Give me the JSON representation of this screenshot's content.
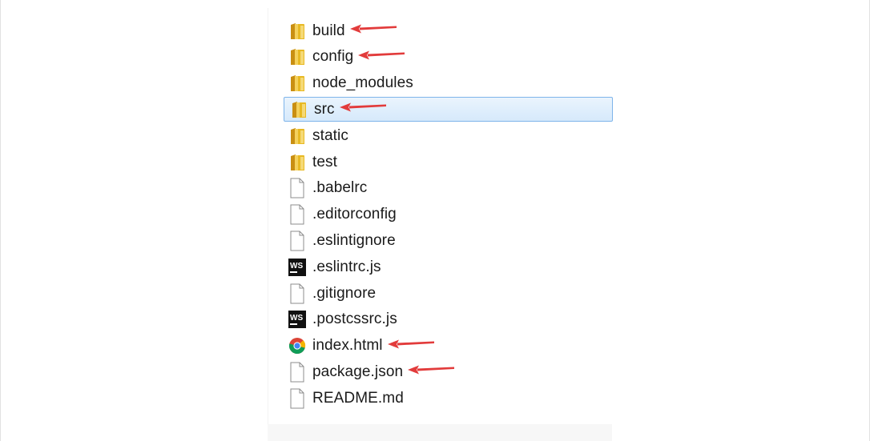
{
  "explorer": {
    "files": [
      {
        "name": "build",
        "kind": "folder",
        "annotated": true
      },
      {
        "name": "config",
        "kind": "folder",
        "annotated": true
      },
      {
        "name": "node_modules",
        "kind": "folder",
        "annotated": false
      },
      {
        "name": "src",
        "kind": "folder",
        "annotated": true,
        "selected": true
      },
      {
        "name": "static",
        "kind": "folder",
        "annotated": false
      },
      {
        "name": "test",
        "kind": "folder",
        "annotated": false
      },
      {
        "name": ".babelrc",
        "kind": "file",
        "annotated": false
      },
      {
        "name": ".editorconfig",
        "kind": "file",
        "annotated": false
      },
      {
        "name": ".eslintignore",
        "kind": "file",
        "annotated": false
      },
      {
        "name": ".eslintrc.js",
        "kind": "webstorm-js",
        "annotated": false
      },
      {
        "name": ".gitignore",
        "kind": "file",
        "annotated": false
      },
      {
        "name": ".postcssrc.js",
        "kind": "webstorm-js",
        "annotated": false
      },
      {
        "name": "index.html",
        "kind": "chrome-html",
        "annotated": true
      },
      {
        "name": "package.json",
        "kind": "file",
        "annotated": true
      },
      {
        "name": "README.md",
        "kind": "file",
        "annotated": false
      }
    ]
  },
  "icons": {
    "folder": "folder-icon",
    "file": "file-icon",
    "webstorm-js": "webstorm-js-icon",
    "chrome-html": "chrome-icon",
    "arrow": "red-arrow-annotation"
  },
  "colors": {
    "folder": "#e8b923",
    "selection_bg": "#d6e9fb",
    "selection_border": "#7eb4ea",
    "arrow": "#e23b3b"
  }
}
